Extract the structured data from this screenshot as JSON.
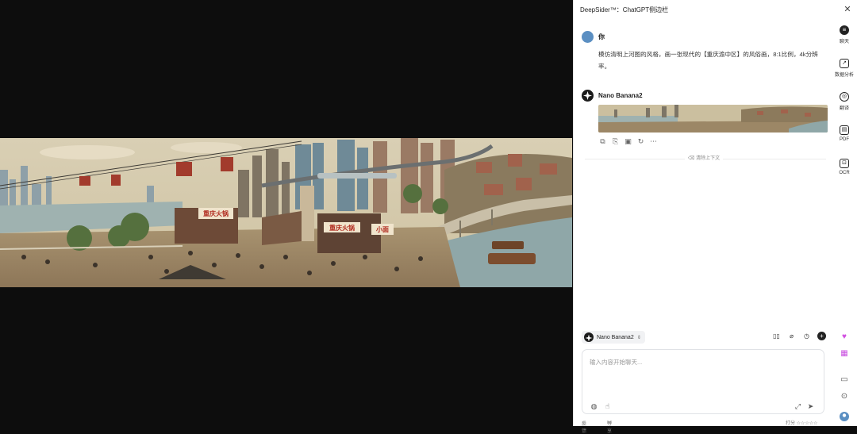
{
  "panel": {
    "title": "DeepSider™：ChatGPT侧边栏",
    "close": "✕"
  },
  "chat": {
    "user": {
      "name": "你",
      "message": "模仿清明上河图的风格，画一张现代的【重庆渝中区】的风俗画，8:1比例，4k分辨率。"
    },
    "bot": {
      "name": "Nano Banana2",
      "actions": [
        "copy-icon",
        "export-icon",
        "image-icon",
        "refresh-icon",
        "more-icon"
      ]
    },
    "clear_context": "清除上下文"
  },
  "rail": [
    {
      "label": "聊天",
      "icon": "chat-icon"
    },
    {
      "label": "数据分析",
      "icon": "data-analysis-icon"
    },
    {
      "label": "翻译",
      "icon": "translate-icon"
    },
    {
      "label": "PDF",
      "icon": "pdf-icon"
    },
    {
      "label": "OCR",
      "icon": "ocr-icon"
    }
  ],
  "composer": {
    "model": "Nano Banana2",
    "placeholder": "输入内容开始聊天...",
    "tools": [
      "book-icon",
      "attachment-icon",
      "history-icon",
      "new-chat-icon"
    ]
  },
  "footer": {
    "feedback": "反馈",
    "share": "分享",
    "rate": "打分 ☆☆☆☆☆"
  },
  "colors": {
    "accent_purple": "#d14fe0",
    "panel_bg": "#ffffff",
    "viewer_bg": "#0d0d0d"
  }
}
